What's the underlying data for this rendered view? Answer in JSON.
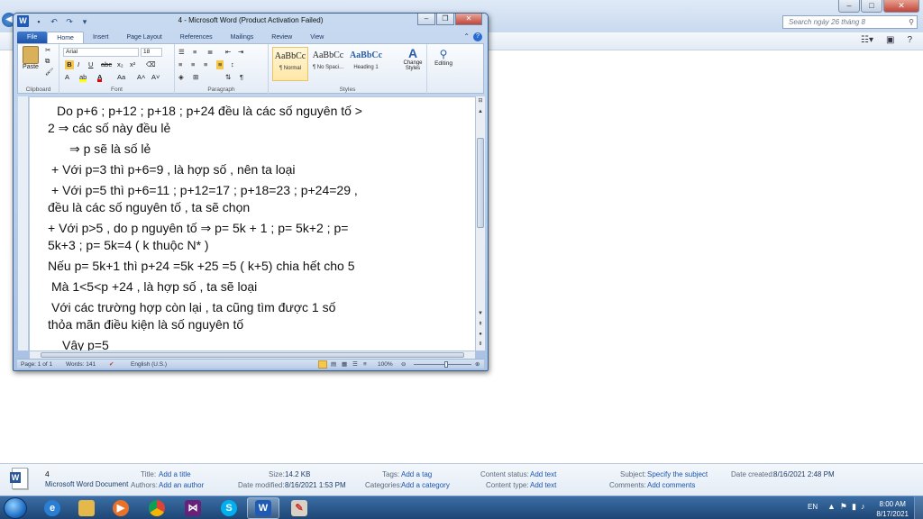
{
  "explorer": {
    "search_placeholder": "Search ngày 26 tháng 8",
    "win_minimize": "–",
    "win_maximize": "□",
    "win_close": "✕",
    "details": {
      "file_name": "4",
      "file_type": "Microsoft Word Document",
      "title_label": "Title:",
      "title_value": "Add a title",
      "authors_label": "Authors:",
      "authors_value": "Add an author",
      "size_label": "Size:",
      "size_value": "14.2 KB",
      "modified_label": "Date modified:",
      "modified_value": "8/16/2021 1:53 PM",
      "tags_label": "Tags:",
      "tags_value": "Add a tag",
      "categories_label": "Categories:",
      "categories_value": "Add a category",
      "content_status_label": "Content status:",
      "content_status_value": "Add text",
      "content_type_label": "Content type:",
      "content_type_value": "Add text",
      "subject_label": "Subject:",
      "subject_value": "Specify the subject",
      "comments_label": "Comments:",
      "comments_value": "Add comments",
      "created_label": "Date created:",
      "created_value": "8/16/2021 2:48 PM"
    }
  },
  "taskbar": {
    "apps": [
      "explorer",
      "media-player",
      "chrome",
      "visual-studio",
      "skype",
      "word",
      "paint"
    ],
    "language": "EN",
    "time": "8:00 AM",
    "date": "8/17/2021"
  },
  "word": {
    "title": "4 - Microsoft Word (Product Activation Failed)",
    "tabs": [
      "File",
      "Home",
      "Insert",
      "Page Layout",
      "References",
      "Mailings",
      "Review",
      "View"
    ],
    "active_tab": "Home",
    "ribbon": {
      "paste_label": "Paste",
      "font_name": "Arial",
      "font_size": "18",
      "groups": {
        "clipboard": "Clipboard",
        "font": "Font",
        "paragraph": "Paragraph",
        "styles": "Styles",
        "editing": "Editing"
      },
      "styles": [
        {
          "sample": "AaBbCc",
          "name": "¶ Normal"
        },
        {
          "sample": "AaBbCc",
          "name": "¶ No Spaci..."
        },
        {
          "sample": "AaBbCc",
          "name": "Heading 1"
        }
      ],
      "change_styles": "Change Styles",
      "editing_label": "Editing"
    },
    "document": {
      "lines": [
        "Do p+6 ; p+12 ; p+18 ; p+24 đều là các số nguyên tố >",
        "2 ⇒ các số này đều lẻ",
        "⇒ p sẽ là số lẻ",
        "+ Với p=3 thì p+6=9 , là hợp số , nên ta loại",
        "+ Với p=5 thì p+6=11 ; p+12=17 ; p+18=23 ; p+24=29 ,",
        "đều là các số nguyên tố , ta sẽ chọn",
        "+ Với p>5 , do p nguyên tố ⇒ p= 5k + 1 ; p= 5k+2 ; p=",
        "5k+3 ; p= 5k=4  ( k thuộc N* )",
        "Nếu p= 5k+1 thì p+24 =5k +25 =5 ( k+5) chia hết cho 5",
        "Mà 1<5<p +24 , là hợp số , ta sẽ loại",
        "Với các trường hợp còn lại , ta cũng tìm được 1 số",
        "thỏa mãn điều kiện là số nguyên tố",
        "Vậy p=5"
      ]
    },
    "statusbar": {
      "page": "Page: 1 of 1",
      "words": "Words: 141",
      "language": "English (U.S.)",
      "zoom": "100%"
    }
  }
}
